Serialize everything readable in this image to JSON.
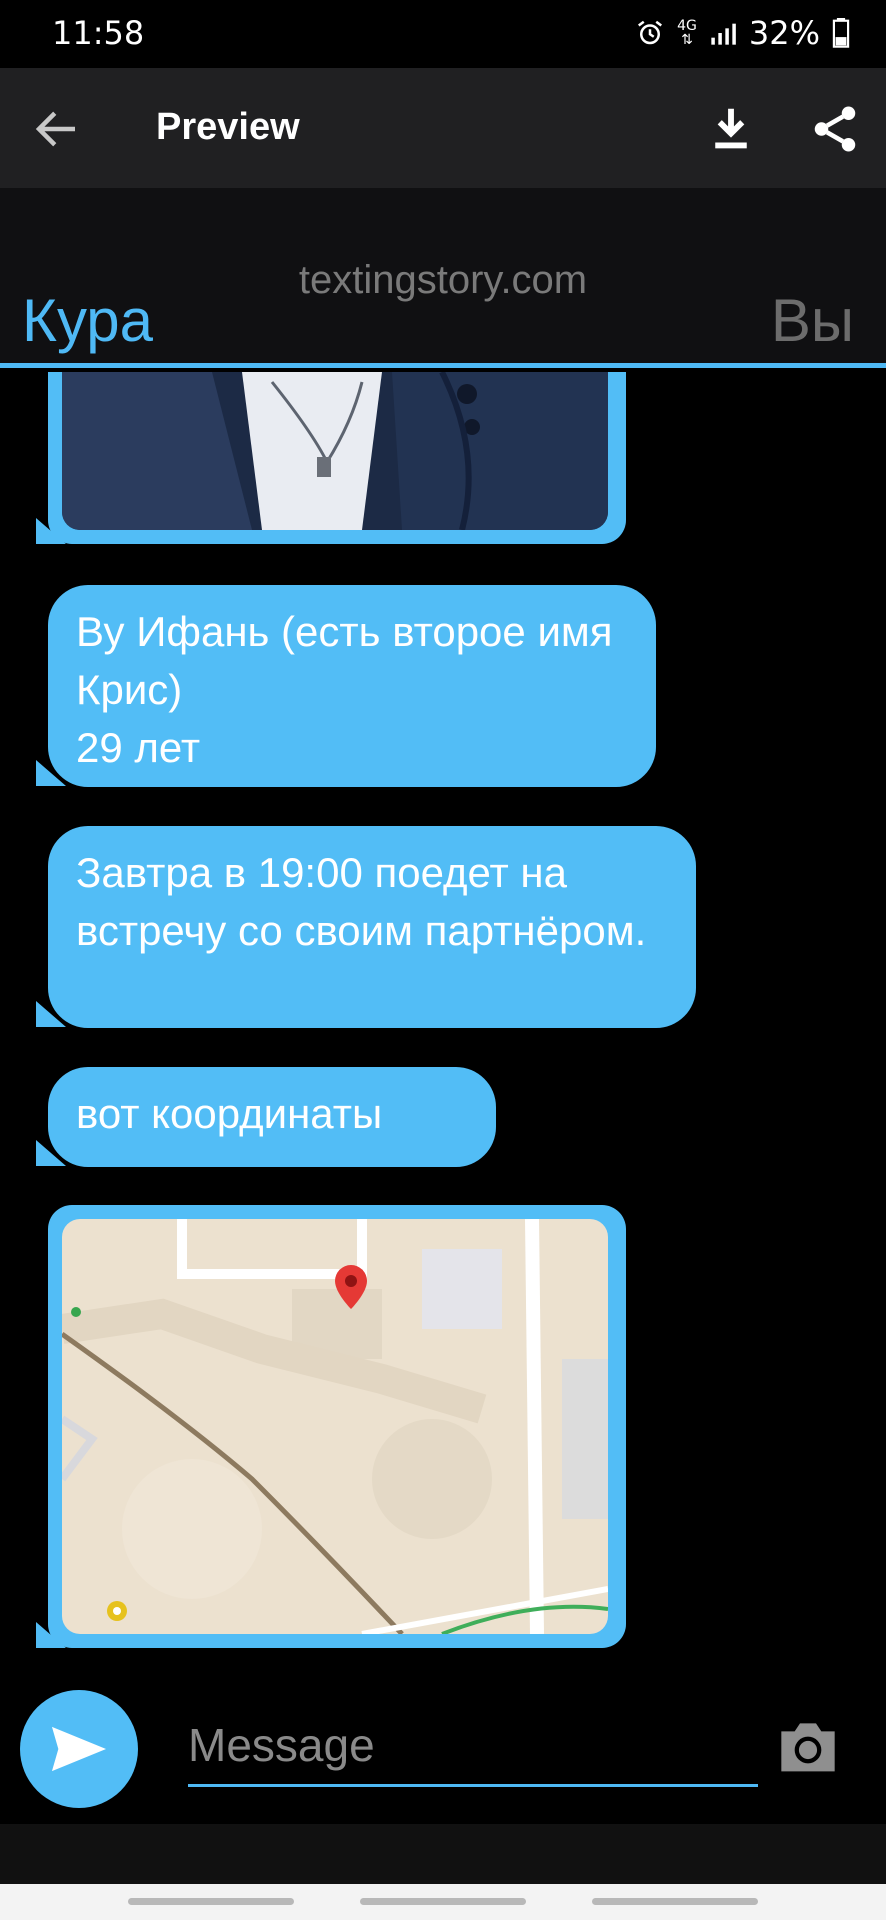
{
  "status": {
    "time": "11:58",
    "network": "4G",
    "battery": "32%"
  },
  "appbar": {
    "title": "Preview"
  },
  "header": {
    "site": "textingstory.com",
    "left_name": "Кура",
    "right_name": "Вы"
  },
  "messages": {
    "m1": "Ву Ифань (есть второе имя Крис)\n 29 лет",
    "m2": "Завтра в 19:00 поедет на встречу со своим партнёром.",
    "m3": "вот координаты"
  },
  "composer": {
    "placeholder": "Message"
  },
  "colors": {
    "accent": "#52bdf6",
    "appbar": "#202022",
    "background": "#000000"
  }
}
